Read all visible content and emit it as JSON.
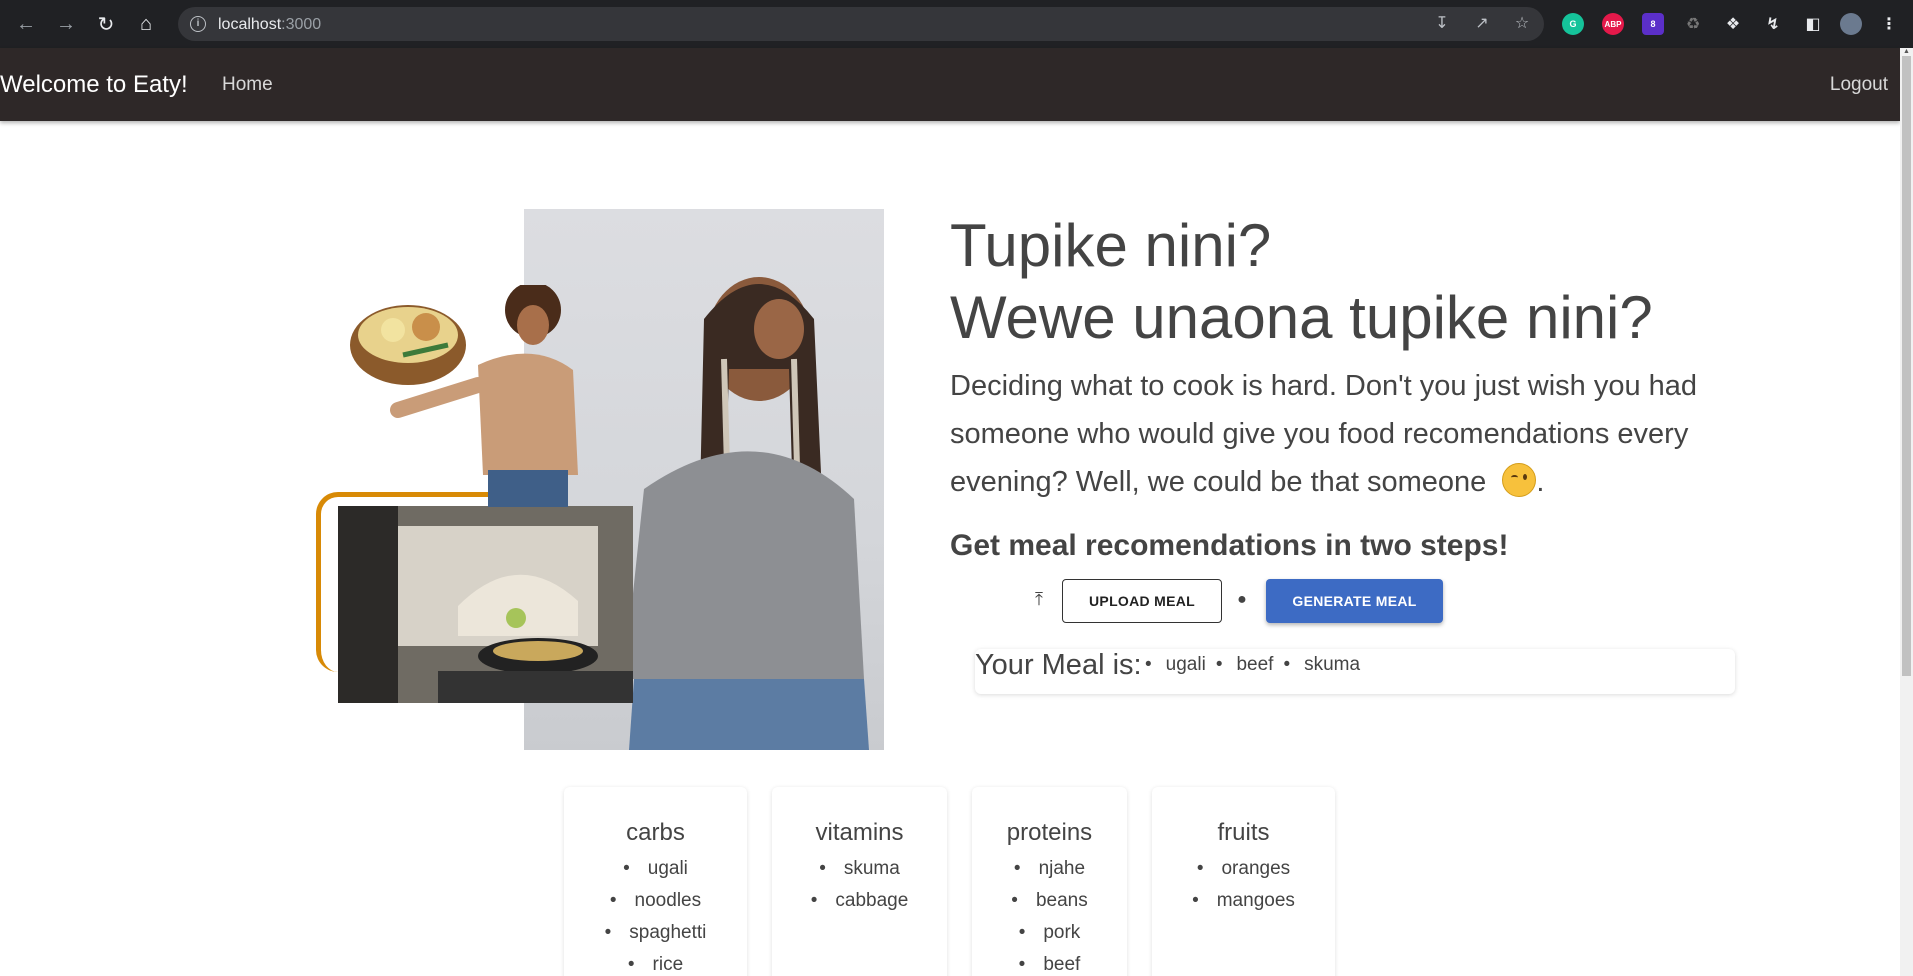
{
  "browser": {
    "url_host": "localhost",
    "url_port": ":3000",
    "extensions": [
      "G",
      "ABP",
      "8"
    ]
  },
  "navbar": {
    "brand": "Welcome to Eaty!",
    "home": "Home",
    "logout": "Logout"
  },
  "hero": {
    "title_line1": "Tupike nini?",
    "title_line2": "Wewe unaona tupike nini?",
    "description": "Deciding what to cook is hard. Don't you just wish you had someone who would give you food recomendations every evening? Well, we could be that someone",
    "description_end": ".",
    "steps_heading": "Get meal recomendations in two steps!",
    "upload_label": "UPLOAD MEAL",
    "generate_label": "GENERATE MEAL"
  },
  "meal": {
    "label": "Your Meal is:",
    "items": [
      "ugali",
      "beef",
      "skuma"
    ]
  },
  "categories": [
    {
      "title": "carbs",
      "items": [
        "ugali",
        "noodles",
        "spaghetti",
        "rice"
      ]
    },
    {
      "title": "vitamins",
      "items": [
        "skuma",
        "cabbage"
      ]
    },
    {
      "title": "proteins",
      "items": [
        "njahe",
        "beans",
        "pork",
        "beef"
      ]
    },
    {
      "title": "fruits",
      "items": [
        "oranges",
        "mangoes"
      ]
    }
  ]
}
